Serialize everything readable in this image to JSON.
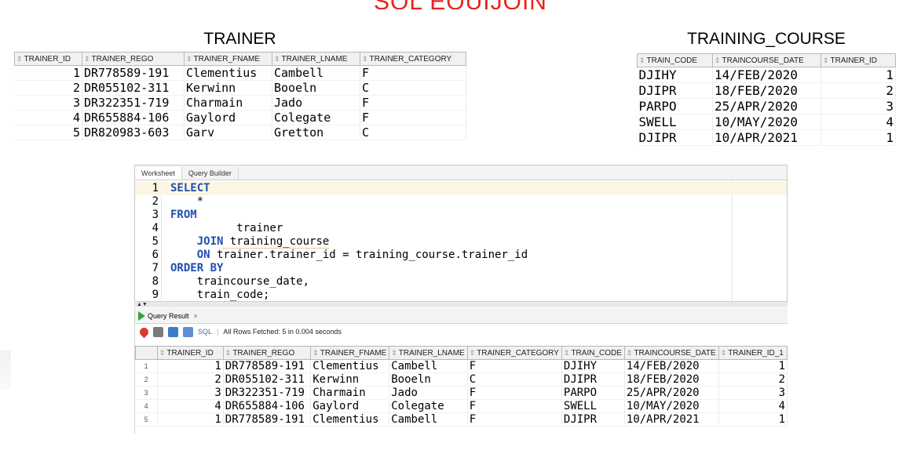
{
  "slide": {
    "title": "SQL EQUIJOIN",
    "title_color": "#e8231c"
  },
  "trainer": {
    "caption": "TRAINER",
    "columns": [
      "TRAINER_ID",
      "TRAINER_REGO",
      "TRAINER_FNAME",
      "TRAINER_LNAME",
      "TRAINER_CATEGORY"
    ],
    "rows": [
      [
        "1",
        "DR778589-191",
        "Clementius",
        "Cambell",
        "F"
      ],
      [
        "2",
        "DR055102-311",
        "Kerwinn",
        "Booeln",
        "C"
      ],
      [
        "3",
        "DR322351-719",
        "Charmain",
        "Jado",
        "F"
      ],
      [
        "4",
        "DR655884-106",
        "Gaylord",
        "Colegate",
        "F"
      ],
      [
        "5",
        "DR820983-603",
        "Garv",
        "Gretton",
        "C"
      ]
    ]
  },
  "training_course": {
    "caption": "TRAINING_COURSE",
    "columns": [
      "TRAIN_CODE",
      "TRAINCOURSE_DATE",
      "TRAINER_ID"
    ],
    "rows": [
      [
        "DJIHY",
        "14/FEB/2020",
        "1"
      ],
      [
        "DJIPR",
        "18/FEB/2020",
        "2"
      ],
      [
        "PARPO",
        "25/APR/2020",
        "3"
      ],
      [
        "SWELL",
        "10/MAY/2020",
        "4"
      ],
      [
        "DJIPR",
        "10/APR/2021",
        "1"
      ]
    ]
  },
  "worksheet": {
    "tabs": [
      "Worksheet",
      "Query Builder"
    ],
    "lines": [
      {
        "n": "1",
        "kw": "SELECT",
        "rest": ""
      },
      {
        "n": "2",
        "kw": "",
        "rest": "    *"
      },
      {
        "n": "3",
        "kw": "FROM",
        "rest": ""
      },
      {
        "n": "4",
        "kw": "",
        "rest": "          trainer"
      },
      {
        "n": "5",
        "kw": "    JOIN",
        "rest": " training_course"
      },
      {
        "n": "6",
        "kw": "    ON",
        "rest": " trainer.trainer_id = training_course.trainer_id"
      },
      {
        "n": "7",
        "kw": "ORDER BY",
        "rest": ""
      },
      {
        "n": "8",
        "kw": "",
        "rest": "    traincourse_date,"
      },
      {
        "n": "9",
        "kw": "",
        "rest": "    train_code;"
      }
    ]
  },
  "query_result": {
    "tab": "Query Result",
    "sql_label": "SQL",
    "status": "All Rows Fetched: 5 in 0.004 seconds",
    "columns": [
      "TRAINER_ID",
      "TRAINER_REGO",
      "TRAINER_FNAME",
      "TRAINER_LNAME",
      "TRAINER_CATEGORY",
      "TRAIN_CODE",
      "TRAINCOURSE_DATE",
      "TRAINER_ID_1"
    ],
    "rows": [
      [
        "1",
        "1",
        "DR778589-191",
        "Clementius",
        "Cambell",
        "F",
        "DJIHY",
        "14/FEB/2020",
        "1"
      ],
      [
        "2",
        "2",
        "DR055102-311",
        "Kerwinn",
        "Booeln",
        "C",
        "DJIPR",
        "18/FEB/2020",
        "2"
      ],
      [
        "3",
        "3",
        "DR322351-719",
        "Charmain",
        "Jado",
        "F",
        "PARPO",
        "25/APR/2020",
        "3"
      ],
      [
        "4",
        "4",
        "DR655884-106",
        "Gaylord",
        "Colegate",
        "F",
        "SWELL",
        "10/MAY/2020",
        "4"
      ],
      [
        "5",
        "1",
        "DR778589-191",
        "Clementius",
        "Cambell",
        "F",
        "DJIPR",
        "10/APR/2021",
        "1"
      ]
    ]
  }
}
